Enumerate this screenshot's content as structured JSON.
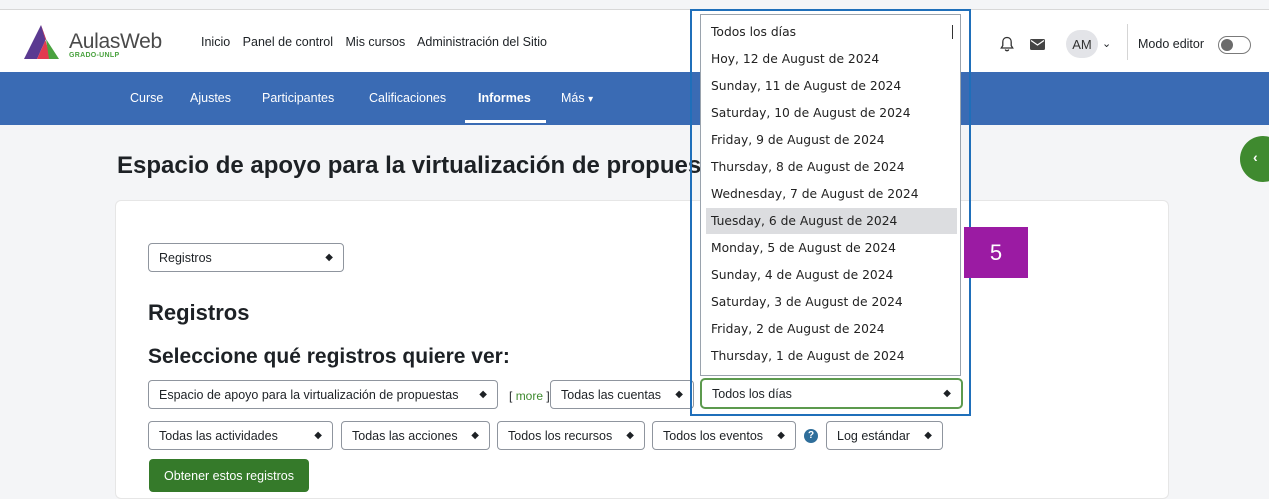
{
  "brand": {
    "name": "AulasWeb",
    "sub": "GRADO-UNLP"
  },
  "topnav": [
    "Inicio",
    "Panel de control",
    "Mis cursos",
    "Administración del Sitio"
  ],
  "user": {
    "initials": "AM",
    "editor_mode_label": "Modo editor"
  },
  "icons": {
    "bell": "bell-icon",
    "mail": "envelope-icon",
    "caret": "chevron-down-icon"
  },
  "secnav": {
    "items": [
      "Curse",
      "Ajustes",
      "Participantes",
      "Calificaciones",
      "Informes",
      "Más"
    ],
    "active": "Informes"
  },
  "page": {
    "title": "Espacio de apoyo para la virtualización de propues"
  },
  "report": {
    "report_type": "Registros",
    "heading": "Registros",
    "subheading": "Seleccione qué registros quiere ver:",
    "course_select": "Espacio de apoyo para la virtualización de propuestas",
    "more_bracket_left": "[",
    "more_label": "more",
    "more_bracket_right": "]",
    "user_select": "Todas las cuentas",
    "day_select": "Todos los días",
    "activity_select": "Todas las actividades",
    "action_select": "Todas las acciones",
    "resource_select": "Todos los recursos",
    "event_select": "Todos los eventos",
    "log_select": "Log estándar",
    "submit": "Obtener estos registros"
  },
  "day_options": [
    "Todos los días",
    "Hoy, 12 de August de 2024",
    "Sunday, 11 de August de 2024",
    "Saturday, 10 de August de 2024",
    "Friday, 9 de August de 2024",
    "Thursday, 8 de August de 2024",
    "Wednesday, 7 de August de 2024",
    "Tuesday, 6 de August de 2024",
    "Monday, 5 de August de 2024",
    "Sunday, 4 de August de 2024",
    "Saturday, 3 de August de 2024",
    "Friday, 2 de August de 2024",
    "Thursday, 1 de August de 2024"
  ],
  "highlighted_option": "Tuesday, 6 de August de 2024",
  "annotation": {
    "label": "5",
    "color": "#9b1ba3",
    "box_color": "#1f6fba"
  },
  "colors": {
    "brand_blue": "#3a6bb4",
    "accent_green": "#357a2a"
  }
}
